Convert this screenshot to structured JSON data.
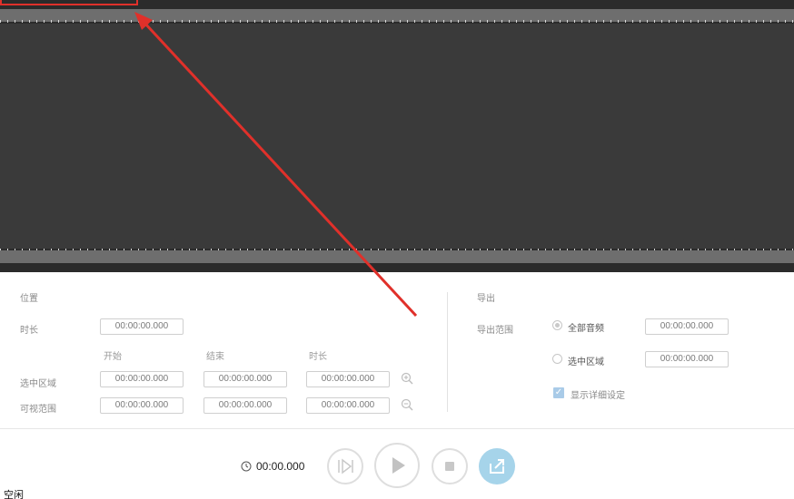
{
  "position": {
    "heading": "位置",
    "duration_label": "时长",
    "duration_value": "00:00:00.000",
    "col_start": "开始",
    "col_end": "结束",
    "col_duration": "时长",
    "selection_label": "选中区域",
    "selection": {
      "start": "00:00:00.000",
      "end": "00:00:00.000",
      "duration": "00:00:00.000"
    },
    "visible_label": "可视范围",
    "visible": {
      "start": "00:00:00.000",
      "end": "00:00:00.000",
      "duration": "00:00:00.000"
    }
  },
  "export": {
    "heading": "导出",
    "range_label": "导出范围",
    "option_all": "全部音频",
    "option_all_value": "00:00:00.000",
    "option_selection": "选中区域",
    "option_selection_value": "00:00:00.000",
    "show_details": "显示详细设定"
  },
  "transport": {
    "time": "00:00.000"
  },
  "status": "空闲",
  "colors": {
    "waveform_bg": "#3a3a3a",
    "annotation": "#e0302a",
    "export_button": "#a6d4ea"
  },
  "icons": [
    "zoom-in-icon",
    "zoom-out-icon",
    "clock-icon",
    "skip-frame-icon",
    "play-icon",
    "stop-icon",
    "export-icon"
  ]
}
